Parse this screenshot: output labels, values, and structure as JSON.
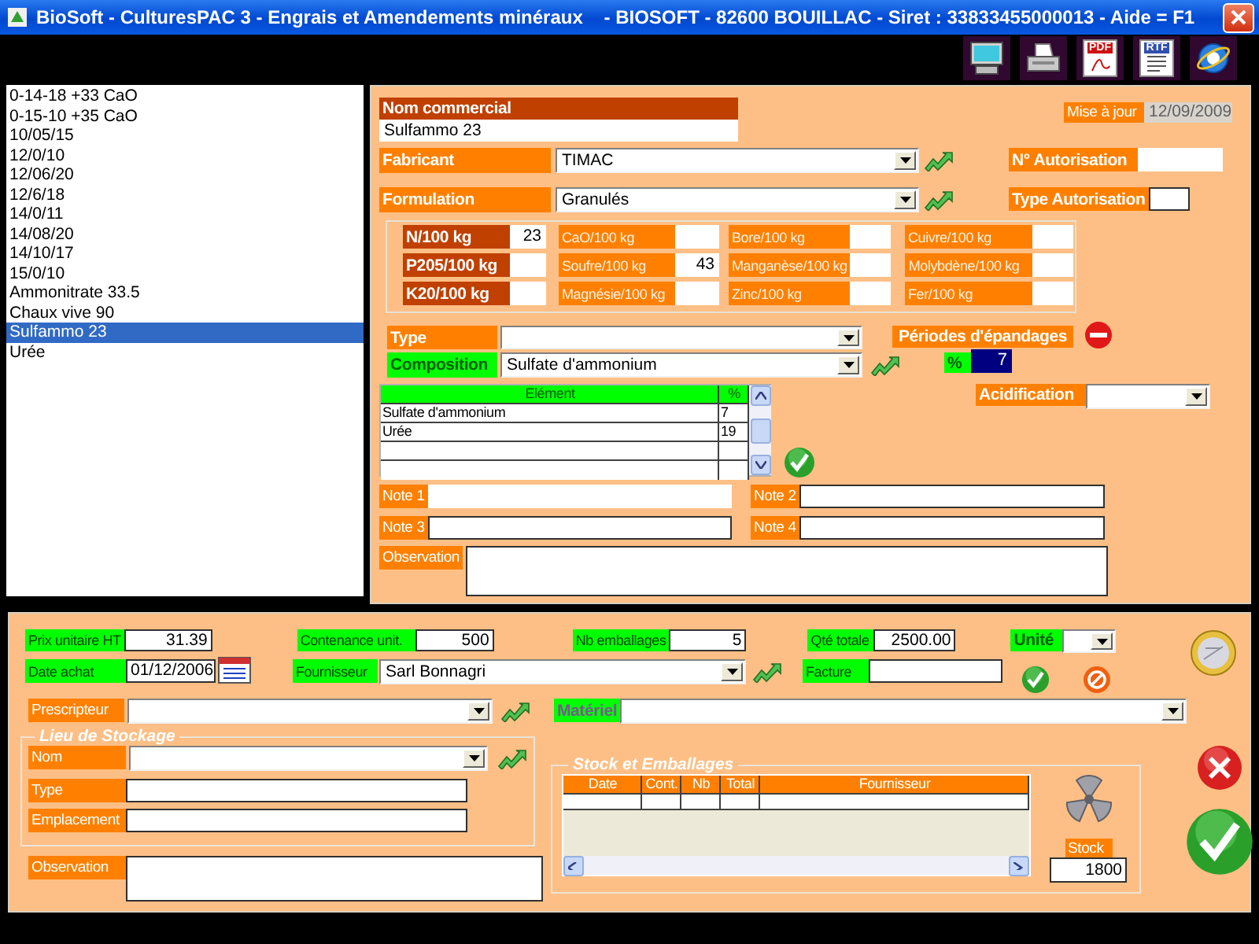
{
  "window": {
    "title": "BioSoft - CulturesPAC 3 - Engrais et Amendements minéraux    - BIOSOFT - 82600 BOUILLAC - Siret : 33833455000013 - Aide = F1"
  },
  "toolbar": [
    {
      "kind": "monitor"
    },
    {
      "kind": "printer"
    },
    {
      "kind": "document",
      "label": "PDF"
    },
    {
      "kind": "document",
      "label": "RTF"
    },
    {
      "kind": "browser"
    }
  ],
  "products": [
    {
      "name": "0-14-18 +33 CaO",
      "selected": false
    },
    {
      "name": "0-15-10 +35 CaO",
      "selected": false
    },
    {
      "name": "10/05/15",
      "selected": false
    },
    {
      "name": "12/0/10",
      "selected": false
    },
    {
      "name": "12/06/20",
      "selected": false
    },
    {
      "name": "12/6/18",
      "selected": false
    },
    {
      "name": "14/0/11",
      "selected": false
    },
    {
      "name": "14/08/20",
      "selected": false
    },
    {
      "name": "14/10/17",
      "selected": false
    },
    {
      "name": "15/0/10",
      "selected": false
    },
    {
      "name": "Ammonitrate 33.5",
      "selected": false
    },
    {
      "name": "Chaux vive 90",
      "selected": false
    },
    {
      "name": "Sulfammo 23",
      "selected": true
    },
    {
      "name": "Urée",
      "selected": false
    }
  ],
  "product": {
    "nom_commercial": {
      "label": "Nom commercial",
      "value": "Sulfammo 23"
    },
    "mise_a_jour": {
      "label": "Mise à jour",
      "value": "12/09/2009",
      "disabled": true
    },
    "fabricant": {
      "label": "Fabricant",
      "value": "TIMAC"
    },
    "formulation": {
      "label": "Formulation",
      "value": "Granulés"
    },
    "n_autorisation": {
      "label": "N° Autorisation"
    },
    "type_autorisation": {
      "label": "Type Autorisation"
    },
    "nutrients": [
      [
        {
          "label": "N/100 kg",
          "value": "23",
          "kind": "major"
        },
        {
          "label": "CaO/100 kg",
          "kind": "minor"
        },
        {
          "label": "Bore/100 kg",
          "kind": "minor"
        },
        {
          "label": "Cuivre/100 kg",
          "kind": "minor"
        }
      ],
      [
        {
          "label": "P205/100 kg",
          "kind": "major"
        },
        {
          "label": "Soufre/100 kg",
          "value": "43",
          "kind": "minor"
        },
        {
          "label": "Manganèse/100 kg",
          "kind": "minor"
        },
        {
          "label": "Molybdène/100 kg",
          "kind": "minor"
        }
      ],
      [
        {
          "label": "K20/100 kg",
          "kind": "major"
        },
        {
          "label": "Magnésie/100 kg",
          "kind": "minor"
        },
        {
          "label": "Zinc/100 kg",
          "kind": "minor"
        },
        {
          "label": "Fer/100 kg",
          "kind": "minor"
        }
      ]
    ],
    "type": {
      "label": "Type"
    },
    "composition": {
      "label": "Composition",
      "value": "Sulfate d'ammonium"
    },
    "periodes": {
      "label": "Périodes d'épandages"
    },
    "percent": {
      "label": "%",
      "value": "7"
    },
    "acidification": {
      "label": "Acidification"
    },
    "elements": {
      "columns": [
        "Elément",
        "%"
      ],
      "rows": [
        [
          "Sulfate d'ammonium",
          "7"
        ],
        [
          "Urée",
          "19"
        ]
      ]
    },
    "notes": [
      {
        "label": "Note 1"
      },
      {
        "label": "Note 2"
      },
      {
        "label": "Note 3"
      },
      {
        "label": "Note 4"
      }
    ],
    "observation": {
      "label": "Observation"
    }
  },
  "purchase": {
    "prix": {
      "label": "Prix unitaire HT",
      "value": "31.39"
    },
    "contenance": {
      "label": "Contenance unit.",
      "value": "500"
    },
    "nb_emballages": {
      "label": "Nb emballages",
      "value": "5"
    },
    "qte_totale": {
      "label": "Qté totale",
      "value": "2500.00"
    },
    "unite": {
      "label": "Unité"
    },
    "date_achat": {
      "label": "Date achat",
      "value": "01/12/2006"
    },
    "fournisseur": {
      "label": "Fournisseur",
      "value": "Sarl Bonnagri"
    },
    "facture": {
      "label": "Facture"
    },
    "prescripteur": {
      "label": "Prescripteur"
    },
    "materiel": {
      "label": "Matériel",
      "disabled": true
    },
    "lieu_stockage": {
      "title": "Lieu de Stockage",
      "nom": {
        "label": "Nom"
      },
      "type": {
        "label": "Type"
      },
      "emplacement": {
        "label": "Emplacement"
      }
    },
    "observation": {
      "label": "Observation"
    },
    "stock_emballages": {
      "title": "Stock et Emballages",
      "columns": [
        "Date",
        "Cont.",
        "Nb",
        "Total",
        "Fournisseur"
      ]
    },
    "stock": {
      "label": "Stock",
      "value": "1800"
    }
  }
}
